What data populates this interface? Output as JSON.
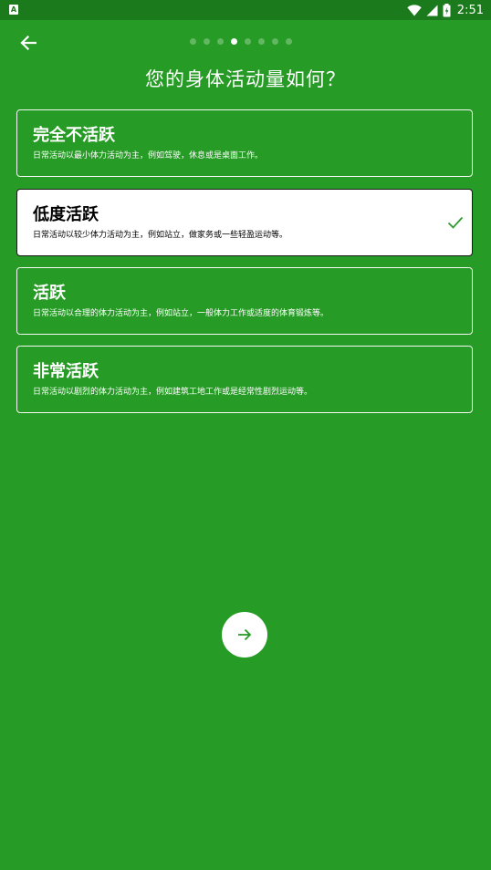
{
  "status_bar": {
    "left_icon": "A",
    "time": "2:51",
    "icons": [
      "wifi-icon",
      "signal-icon",
      "battery-icon"
    ]
  },
  "nav": {
    "back_icon": "arrow-left-icon",
    "dots_total": 8,
    "dots_active_index": 3
  },
  "page_title": "您的身体活动量如何？",
  "options": [
    {
      "title": "完全不活跃",
      "description": "日常活动以最小体力活动为主，例如驾驶，休息或是桌面工作。",
      "selected": false
    },
    {
      "title": "低度活跃",
      "description": "日常活动以较少体力活动为主，例如站立，做家务或一些轻盈运动等。",
      "selected": true
    },
    {
      "title": "活跃",
      "description": "日常活动以合理的体力活动为主，例如站立，一般体力工作或适度的体育锻炼等。",
      "selected": false
    },
    {
      "title": "非常活跃",
      "description": "日常活动以剧烈的体力活动为主，例如建筑工地工作或是经常性剧烈运动等。",
      "selected": false
    }
  ],
  "next_button": {
    "icon": "arrow-right-icon"
  },
  "colors": {
    "background": "#269b25",
    "status_bar": "#1b7a1b",
    "check": "#2e9b2d",
    "card_selected": "#ffffff"
  }
}
